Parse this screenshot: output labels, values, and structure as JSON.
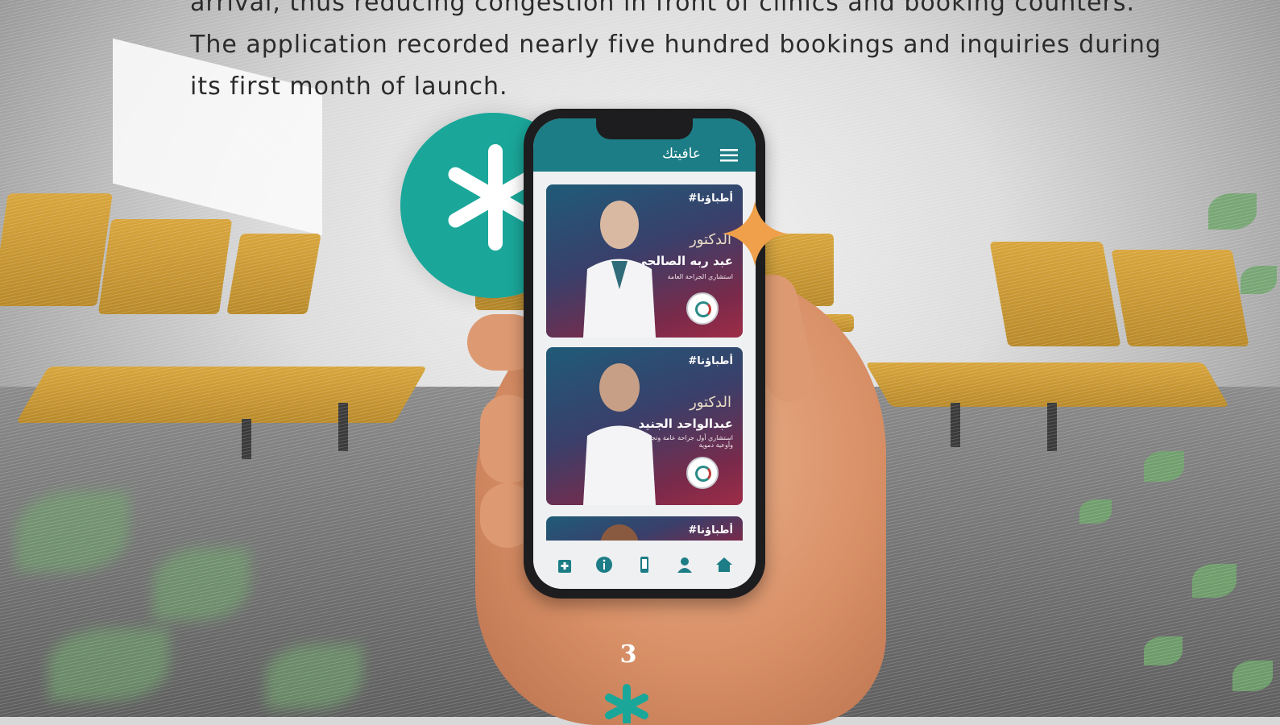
{
  "article": {
    "lines": [
      "arrival, thus reducing congestion in front of clinics and booking counters.",
      "The application recorded nearly five hundred bookings and inquiries during",
      "its first month of launch."
    ]
  },
  "phone_app": {
    "title": "عافيتك",
    "cards": [
      {
        "tag": "#أطباؤنا",
        "doctor_label": "الدكتور",
        "name": "عبد ربه الصالحي",
        "specialty": "استشاري الجراحة العامة"
      },
      {
        "tag": "#أطباؤنا",
        "doctor_label": "الدكتور",
        "name": "عبدالواحد الجنيد",
        "specialty": "استشاري أول جراحة عامة وتجميل وأوعية دموية"
      },
      {
        "tag": "#أطباؤنا"
      }
    ],
    "nav_icons": [
      "hospital-icon",
      "info-icon",
      "phone-icon",
      "user-icon",
      "home-icon"
    ]
  },
  "page": {
    "number": "3"
  },
  "colors": {
    "brand_teal": "#1aa79a",
    "app_bar": "#1d7d86",
    "accent_orange": "#f0a04a",
    "chair_yellow": "#d8a53c"
  }
}
